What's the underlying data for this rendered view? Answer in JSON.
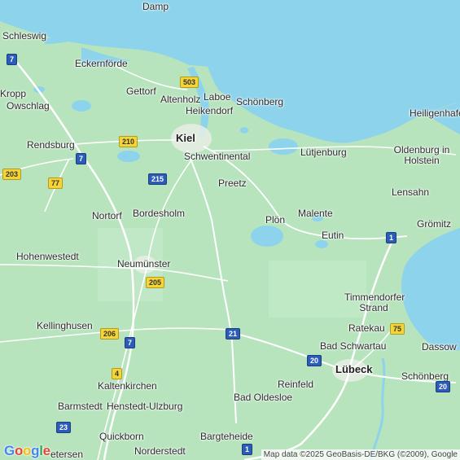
{
  "colors": {
    "water": "#8ed3ec",
    "land": "#b7e4bd",
    "land_light": "#c8ebcc",
    "road_major": "#ffffff",
    "road_motorway": "#a9d2f0"
  },
  "places": [
    {
      "id": "damp",
      "label": "Damp"
    },
    {
      "id": "schleswig",
      "label": "Schleswig"
    },
    {
      "id": "eckernfoerde",
      "label": "Eckernförde"
    },
    {
      "id": "kropp",
      "label": "Kropp"
    },
    {
      "id": "owschlag",
      "label": "Owschlag"
    },
    {
      "id": "gettorf",
      "label": "Gettorf"
    },
    {
      "id": "altenholz",
      "label": "Altenholz"
    },
    {
      "id": "laboe",
      "label": "Laboe"
    },
    {
      "id": "heikendorf",
      "label": "Heikendorf"
    },
    {
      "id": "schoenberg-north",
      "label": "Schönberg"
    },
    {
      "id": "heiligenhafen",
      "label": "Heiligenhafe"
    },
    {
      "id": "kiel",
      "label": "Kiel"
    },
    {
      "id": "rendsburg",
      "label": "Rendsburg"
    },
    {
      "id": "schwentinental",
      "label": "Schwentinental"
    },
    {
      "id": "luetjenburg",
      "label": "Lütjenburg"
    },
    {
      "id": "oldenburg",
      "label": "Oldenburg in Holstein"
    },
    {
      "id": "preetz",
      "label": "Preetz"
    },
    {
      "id": "lensahn",
      "label": "Lensahn"
    },
    {
      "id": "nortorf",
      "label": "Nortorf"
    },
    {
      "id": "bordesholm",
      "label": "Bordesholm"
    },
    {
      "id": "ploen",
      "label": "Plön"
    },
    {
      "id": "malente",
      "label": "Malente"
    },
    {
      "id": "groemitz",
      "label": "Grömitz"
    },
    {
      "id": "eutin",
      "label": "Eutin"
    },
    {
      "id": "hohenwestedt",
      "label": "Hohenwestedt"
    },
    {
      "id": "neumuenster",
      "label": "Neumünster"
    },
    {
      "id": "timmendorfer",
      "label": "Timmendorfer Strand"
    },
    {
      "id": "kellinghusen",
      "label": "Kellinghusen"
    },
    {
      "id": "ratekau",
      "label": "Ratekau"
    },
    {
      "id": "bad-schwartau",
      "label": "Bad Schwartau"
    },
    {
      "id": "dassow",
      "label": "Dassow"
    },
    {
      "id": "luebeck",
      "label": "Lübeck"
    },
    {
      "id": "kaltenkirchen",
      "label": "Kaltenkirchen"
    },
    {
      "id": "reinfeld",
      "label": "Reinfeld"
    },
    {
      "id": "schoenberg-south",
      "label": "Schönberg"
    },
    {
      "id": "bad-oldesloe",
      "label": "Bad Oldesloe"
    },
    {
      "id": "barmstedt",
      "label": "Barmstedt"
    },
    {
      "id": "henstedt",
      "label": "Henstedt-Ulzburg"
    },
    {
      "id": "quickborn",
      "label": "Quickborn"
    },
    {
      "id": "bargteheide",
      "label": "Bargteheide"
    },
    {
      "id": "norderstedt",
      "label": "Norderstedt"
    },
    {
      "id": "elmshorn-partial",
      "label": "etersen"
    }
  ],
  "shields": [
    {
      "id": "a7-north",
      "label": "7",
      "kind": "motorway"
    },
    {
      "id": "b503",
      "label": "503",
      "kind": "federal"
    },
    {
      "id": "b210",
      "label": "210",
      "kind": "federal"
    },
    {
      "id": "a7-rendsburg",
      "label": "7",
      "kind": "motorway"
    },
    {
      "id": "b203",
      "label": "203",
      "kind": "federal"
    },
    {
      "id": "b77",
      "label": "77",
      "kind": "federal"
    },
    {
      "id": "a215",
      "label": "215",
      "kind": "motorway"
    },
    {
      "id": "a1-north",
      "label": "1",
      "kind": "motorway"
    },
    {
      "id": "b205",
      "label": "205",
      "kind": "federal"
    },
    {
      "id": "b206",
      "label": "206",
      "kind": "federal"
    },
    {
      "id": "a21",
      "label": "21",
      "kind": "motorway"
    },
    {
      "id": "b75",
      "label": "75",
      "kind": "federal"
    },
    {
      "id": "a7-south",
      "label": "7",
      "kind": "motorway"
    },
    {
      "id": "a20-luebeck",
      "label": "20",
      "kind": "motorway"
    },
    {
      "id": "b4",
      "label": "4",
      "kind": "federal"
    },
    {
      "id": "a20-east",
      "label": "20",
      "kind": "motorway"
    },
    {
      "id": "a23",
      "label": "23",
      "kind": "motorway"
    },
    {
      "id": "a1-south",
      "label": "1",
      "kind": "motorway"
    }
  ],
  "branding": {
    "logo": "Google"
  },
  "attribution": "Map data ©2025 GeoBasis-DE/BKG (©2009), Google"
}
